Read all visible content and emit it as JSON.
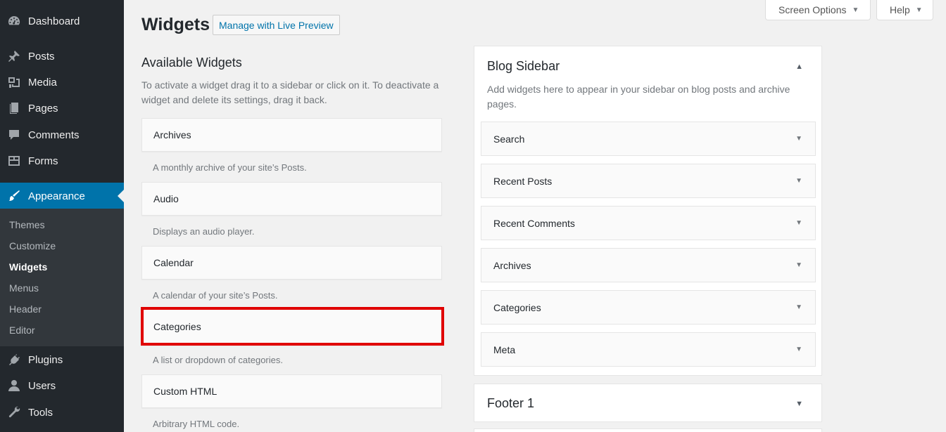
{
  "admin_menu": {
    "dashboard": "Dashboard",
    "posts": "Posts",
    "media": "Media",
    "pages": "Pages",
    "comments": "Comments",
    "forms": "Forms",
    "appearance": "Appearance",
    "submenu": [
      "Themes",
      "Customize",
      "Widgets",
      "Menus",
      "Header",
      "Editor"
    ],
    "plugins": "Plugins",
    "users": "Users",
    "tools": "Tools"
  },
  "top_buttons": {
    "screen_options": "Screen Options",
    "help": "Help"
  },
  "header": {
    "title": "Widgets",
    "live_preview": "Manage with Live Preview"
  },
  "available": {
    "title": "Available Widgets",
    "description": "To activate a widget drag it to a sidebar or click on it. To deactivate a widget and delete its settings, drag it back.",
    "widgets": [
      {
        "name": "Archives",
        "desc": "A monthly archive of your site’s Posts."
      },
      {
        "name": "Audio",
        "desc": "Displays an audio player."
      },
      {
        "name": "Calendar",
        "desc": "A calendar of your site’s Posts."
      },
      {
        "name": "Categories",
        "desc": "A list or dropdown of categories."
      },
      {
        "name": "Custom HTML",
        "desc": "Arbitrary HTML code."
      }
    ]
  },
  "blog_sidebar": {
    "title": "Blog Sidebar",
    "description": "Add widgets here to appear in your sidebar on blog posts and archive pages.",
    "widgets": [
      "Search",
      "Recent Posts",
      "Recent Comments",
      "Archives",
      "Categories",
      "Meta"
    ]
  },
  "footer1": {
    "title": "Footer 1"
  },
  "colors": {
    "menu_bg": "#23282d",
    "menu_active": "#0073aa",
    "highlight": "#e00000"
  }
}
